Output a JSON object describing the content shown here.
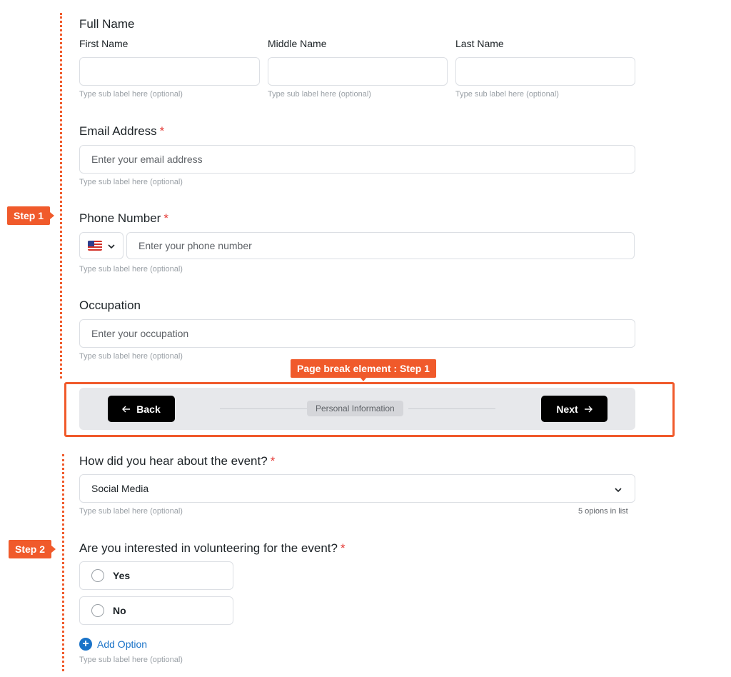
{
  "annotations": {
    "step1": "Step 1",
    "step2": "Step 2",
    "page_break": "Page break element : Step 1"
  },
  "full_name": {
    "title": "Full Name",
    "first": {
      "label": "First Name",
      "value": "",
      "sub": "Type sub label here (optional)"
    },
    "middle": {
      "label": "Middle Name",
      "value": "",
      "sub": "Type sub label here (optional)"
    },
    "last": {
      "label": "Last Name",
      "value": "",
      "sub": "Type sub label here (optional)"
    }
  },
  "email": {
    "title": "Email Address",
    "required": "*",
    "placeholder": "Enter your email address",
    "sub": "Type sub label here (optional)"
  },
  "phone": {
    "title": "Phone Number",
    "required": "*",
    "country_icon": "us-flag-icon",
    "placeholder": "Enter your phone number",
    "sub": "Type sub label here (optional)"
  },
  "occupation": {
    "title": "Occupation",
    "placeholder": "Enter your occupation",
    "sub": "Type sub label here (optional)"
  },
  "pager": {
    "back_label": "Back",
    "next_label": "Next",
    "step_title": "Personal Information"
  },
  "hear_about": {
    "title": "How did you hear about the event?",
    "required": "*",
    "selected": "Social Media",
    "sub": "Type sub label here (optional)",
    "count_note": "5 opions in list"
  },
  "volunteer": {
    "title": "Are you interested in volunteering for the event?",
    "required": "*",
    "options": [
      "Yes",
      "No"
    ],
    "add_option": "Add Option",
    "sub": "Type sub label here (optional)"
  },
  "colors": {
    "accent": "#f05a2b",
    "link": "#1a73c8",
    "required": "#e53935"
  }
}
